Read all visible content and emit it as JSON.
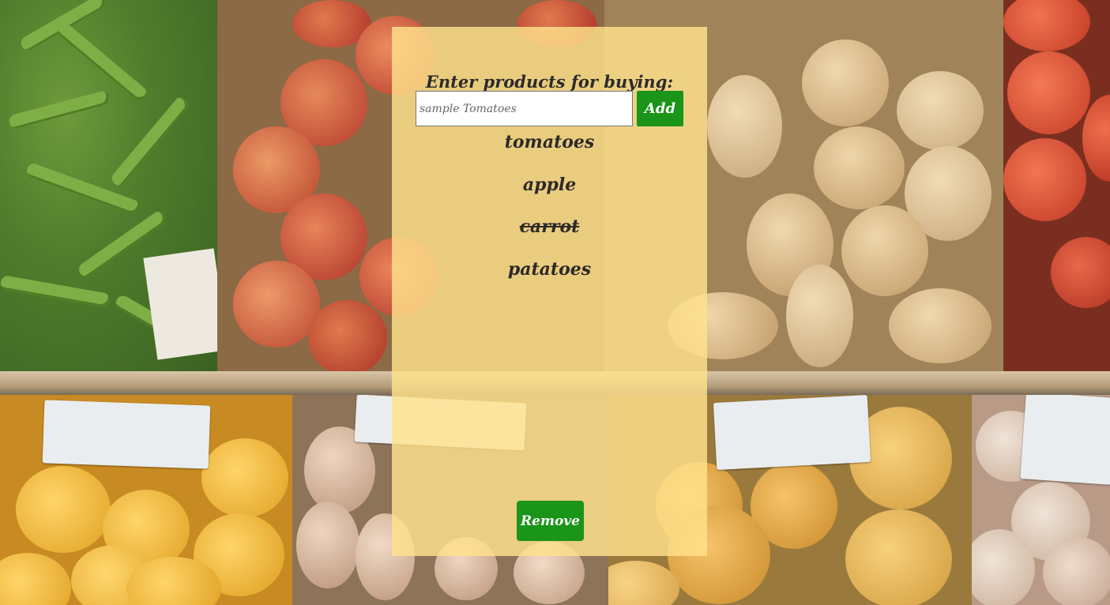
{
  "header": {
    "title": "Enter products for buying:"
  },
  "form": {
    "placeholder": "sample Tomatoes",
    "value": "",
    "add_label": "Add"
  },
  "products": [
    {
      "name": "tomatoes",
      "done": false
    },
    {
      "name": "apple",
      "done": false
    },
    {
      "name": "carrot",
      "done": true
    },
    {
      "name": "patatoes",
      "done": false
    }
  ],
  "actions": {
    "remove_label": "Remove"
  },
  "colors": {
    "panel": "#FFE28C",
    "button": "#1A9419",
    "text": "#2C2A26"
  },
  "background": {
    "description_icon": "produce-market-photo"
  }
}
